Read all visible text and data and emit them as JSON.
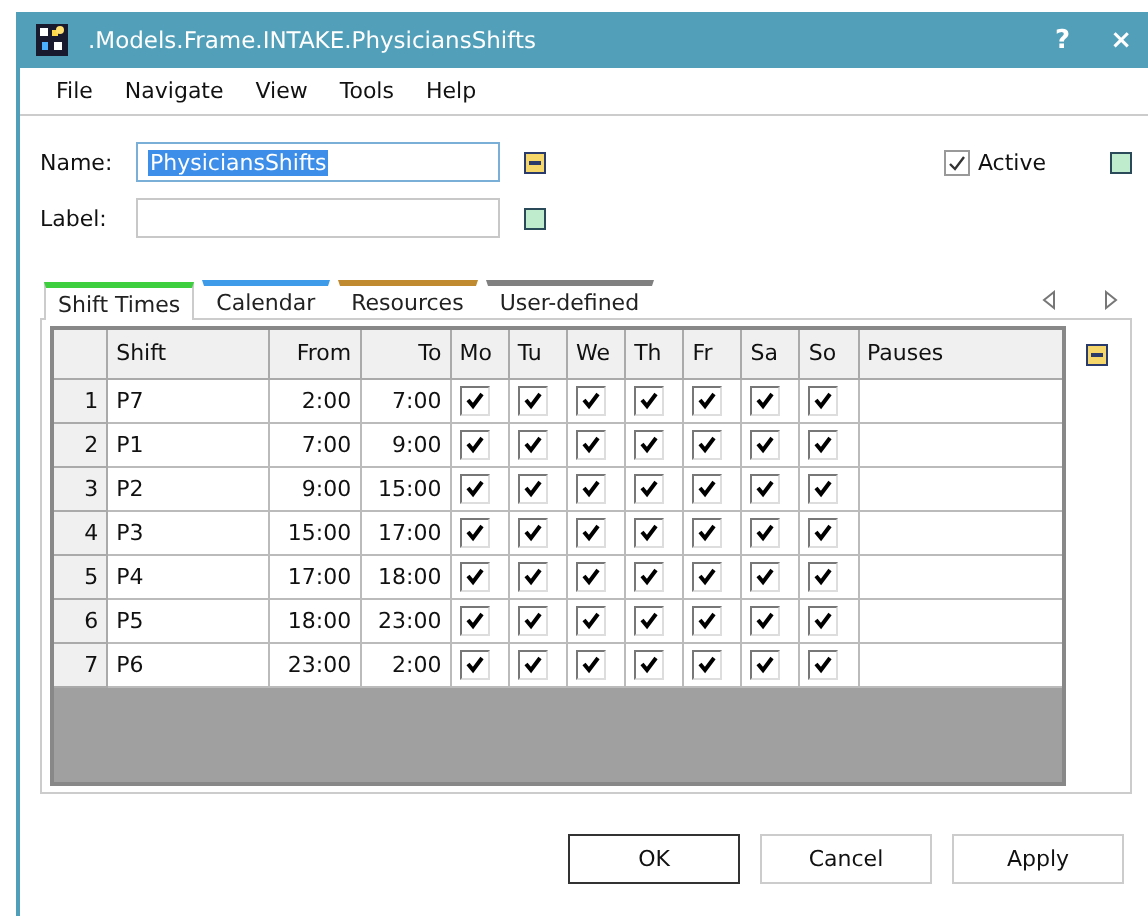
{
  "window": {
    "title": ".Models.Frame.INTAKE.PhysiciansShifts",
    "buttons": [
      "?",
      "×"
    ]
  },
  "menu": [
    "File",
    "Navigate",
    "View",
    "Tools",
    "Help"
  ],
  "form": {
    "name": {
      "label": "Name:",
      "value": "PhysiciansShifts"
    },
    "label": {
      "label": "Label:"
    },
    "active": {
      "label": "Active",
      "checked": true
    }
  },
  "tabs": [
    {
      "label": "Shift Times",
      "selected": true,
      "color": "#3ecf3e"
    },
    {
      "label": "Calendar",
      "selected": false,
      "color": "#3d9be9"
    },
    {
      "label": "Resources",
      "selected": false,
      "color": "#c08a30"
    },
    {
      "label": "User-defined",
      "selected": false,
      "color": "#808080"
    }
  ],
  "table": {
    "columns": [
      "Shift",
      "From",
      "To",
      "Mo",
      "Tu",
      "We",
      "Th",
      "Fr",
      "Sa",
      "So",
      "Pauses"
    ],
    "rows": [
      {
        "index": "1",
        "shift": "P7",
        "from": "2:00",
        "to": "7:00",
        "days": [
          true,
          true,
          true,
          true,
          true,
          true,
          true
        ]
      },
      {
        "index": "2",
        "shift": "P1",
        "from": "7:00",
        "to": "9:00",
        "days": [
          true,
          true,
          true,
          true,
          true,
          true,
          true
        ]
      },
      {
        "index": "3",
        "shift": "P2",
        "from": "9:00",
        "to": "15:00",
        "days": [
          true,
          true,
          true,
          true,
          true,
          true,
          true
        ]
      },
      {
        "index": "4",
        "shift": "P3",
        "from": "15:00",
        "to": "17:00",
        "days": [
          true,
          true,
          true,
          true,
          true,
          true,
          true
        ]
      },
      {
        "index": "5",
        "shift": "P4",
        "from": "17:00",
        "to": "18:00",
        "days": [
          true,
          true,
          true,
          true,
          true,
          true,
          true
        ]
      },
      {
        "index": "6",
        "shift": "P5",
        "from": "18:00",
        "to": "23:00",
        "days": [
          true,
          true,
          true,
          true,
          true,
          true,
          true
        ]
      },
      {
        "index": "7",
        "shift": "P6",
        "from": "23:00",
        "to": "2:00",
        "days": [
          true,
          true,
          true,
          true,
          true,
          true,
          true
        ]
      }
    ]
  },
  "buttons": [
    {
      "label": "OK",
      "default": true
    },
    {
      "label": "Cancel",
      "default": false
    },
    {
      "label": "Apply",
      "default": false
    }
  ]
}
